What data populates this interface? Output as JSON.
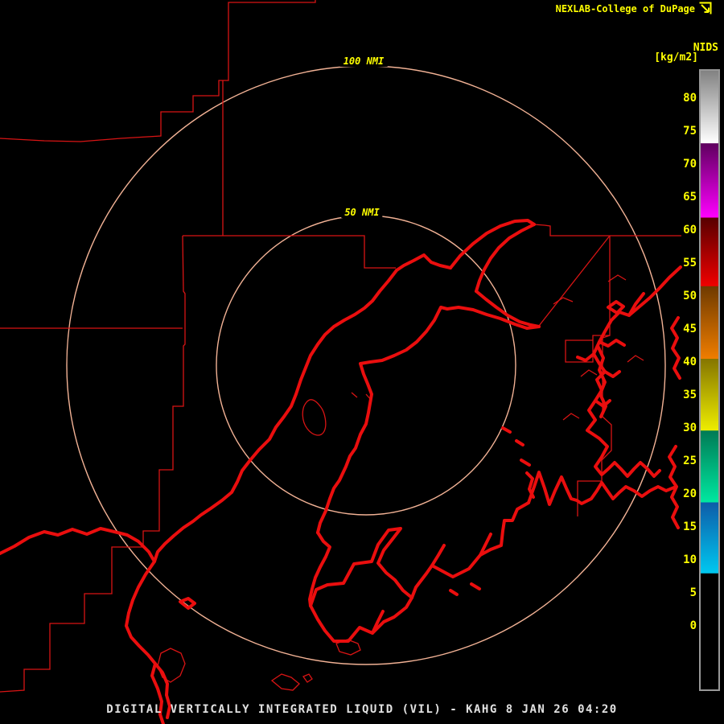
{
  "header": {
    "title": "NEXLAB-College of DuPage",
    "logo_icon": "arrow-box-icon"
  },
  "scale": {
    "product_label": "NIDS",
    "unit_label": "[kg/m2]",
    "tick_values": [
      80,
      75,
      70,
      65,
      60,
      55,
      50,
      45,
      40,
      35,
      30,
      25,
      20,
      15,
      10,
      5,
      0
    ],
    "segments": [
      {
        "from": 73,
        "to": 84,
        "colors": [
          "#828282",
          "#ffffff"
        ],
        "name": "gray"
      },
      {
        "from": 62,
        "to": 73,
        "colors": [
          "#5e005e",
          "#ff00ff"
        ],
        "name": "purple"
      },
      {
        "from": 51.5,
        "to": 62,
        "colors": [
          "#570000",
          "#f00000"
        ],
        "name": "red"
      },
      {
        "from": 40.5,
        "to": 51.5,
        "colors": [
          "#6e3a00",
          "#ef7d00"
        ],
        "name": "orange"
      },
      {
        "from": 30,
        "to": 40.5,
        "colors": [
          "#857500",
          "#eded00"
        ],
        "name": "yellow"
      },
      {
        "from": 19,
        "to": 30,
        "colors": [
          "#007a55",
          "#00e8a0"
        ],
        "name": "teal"
      },
      {
        "from": 8,
        "to": 19,
        "colors": [
          "#0d5ca8",
          "#00c8f0"
        ],
        "name": "blue"
      },
      {
        "from": -9,
        "to": 8,
        "colors": [
          "#000000",
          "#000000"
        ],
        "name": "black"
      }
    ]
  },
  "range_rings": [
    {
      "label": "100 NMI",
      "radius_nmi": 100
    },
    {
      "label": "50 NMI",
      "radius_nmi": 50
    }
  ],
  "footer": {
    "title": "DIGITAL VERTICALLY INTEGRATED LIQUID (VIL) - KAHG 8 JAN 26 04:20"
  },
  "colors": {
    "map_boundary": "#d81414",
    "coastline": "#ea0e0e",
    "range_ring": "#f2b295",
    "label_yellow": "#ffff00",
    "footer_text": "#e2e2e2",
    "background": "#000000"
  }
}
